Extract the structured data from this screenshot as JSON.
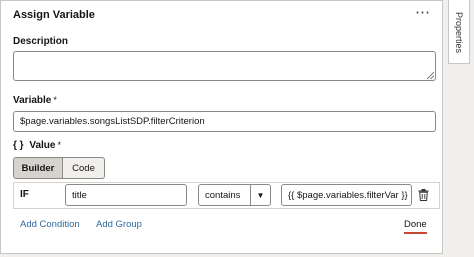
{
  "panel": {
    "title": "Assign Variable",
    "more": "⋯"
  },
  "description": {
    "label": "Description",
    "value": ""
  },
  "variable": {
    "label": "Variable",
    "required": "*",
    "value": "$page.variables.songsListSDP.filterCriterion"
  },
  "value_section": {
    "icon": "{ }",
    "label": "Value",
    "required": "*"
  },
  "mode": {
    "builder": "Builder",
    "code": "Code",
    "selected": "Builder"
  },
  "condition": {
    "if_label": "IF",
    "field": "title",
    "operator": "contains",
    "caret": "▼",
    "value": "{{ $page.variables.filterVar }}"
  },
  "actions": {
    "add_condition": "Add Condition",
    "add_group": "Add Group",
    "done": "Done"
  },
  "side_tab": {
    "label": "Properties"
  }
}
